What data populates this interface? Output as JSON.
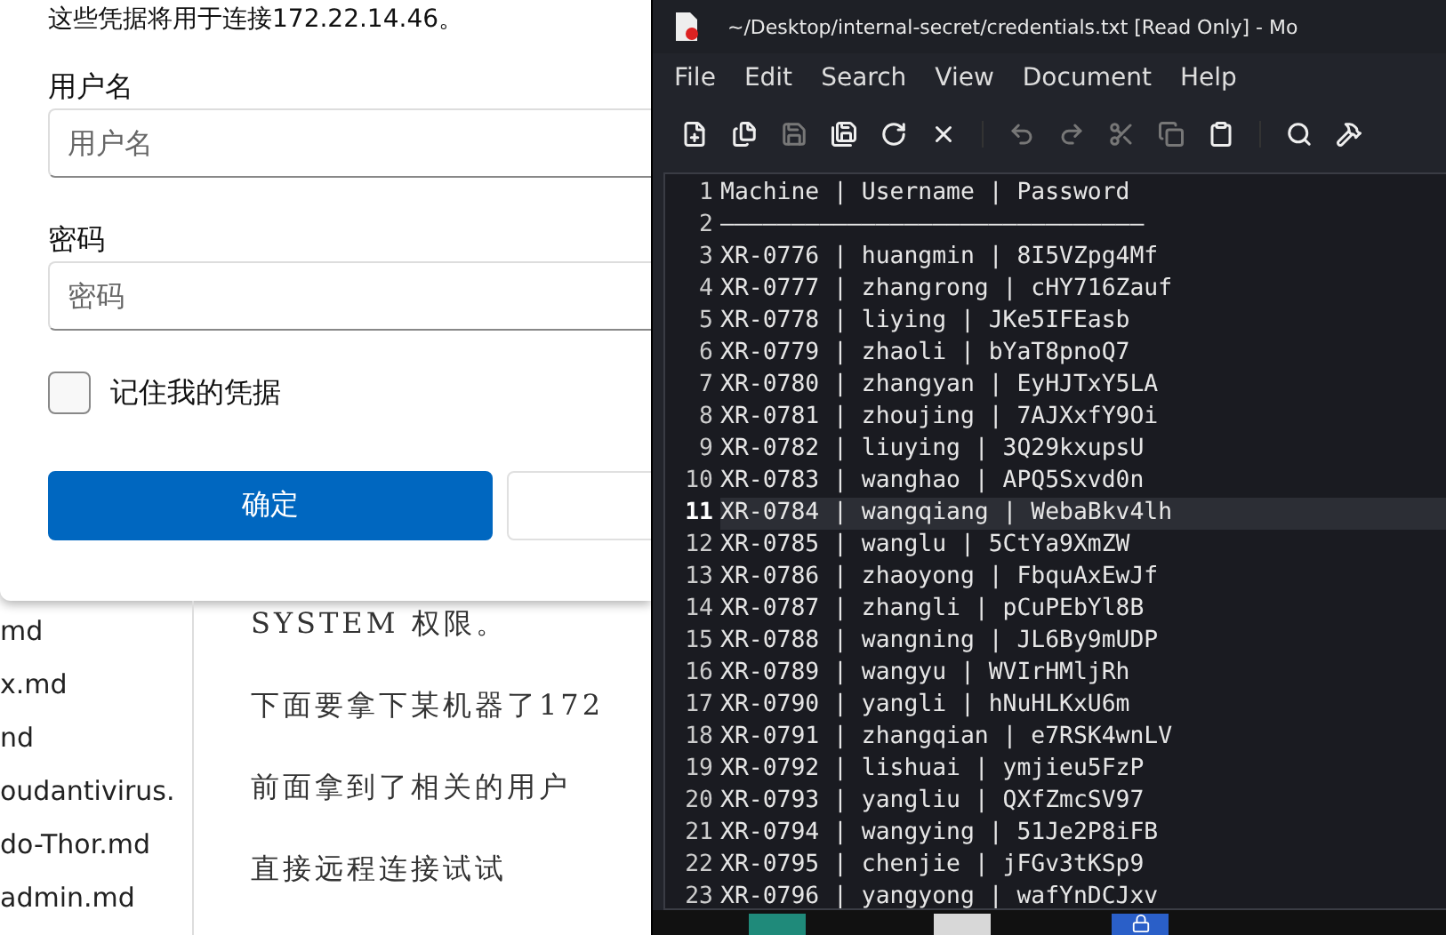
{
  "dialog": {
    "message": "这些凭据将用于连接172.22.14.46。",
    "fields": [
      {
        "label": "用户名",
        "placeholder": "用户名"
      },
      {
        "label": "密码",
        "placeholder": "密码"
      }
    ],
    "remember": {
      "label": "记住我的凭据",
      "checked": false
    },
    "buttons": [
      {
        "label": "确定",
        "primary": true
      },
      {
        "primary": false
      }
    ]
  },
  "background_doc": {
    "sidebar_items": [
      "md",
      "x.md",
      "nd",
      "oudantivirus.",
      "do-Thor.md",
      "admin.md"
    ],
    "paragraphs": [
      "SYSTEM 权限。",
      "下面要拿下某机器了172",
      "前面拿到了相关的用户",
      "直接远程连接试试"
    ]
  },
  "editor": {
    "title": "~/Desktop/internal-secret/credentials.txt [Read Only] - Mo",
    "menu": [
      "File",
      "Edit",
      "Search",
      "View",
      "Document",
      "Help"
    ],
    "toolbar": [
      [
        {
          "disabled": false
        },
        {
          "disabled": false
        },
        {
          "disabled": true
        },
        {
          "disabled": false
        },
        {
          "disabled": false
        },
        {
          "disabled": false
        }
      ],
      [
        {
          "disabled": true
        },
        {
          "disabled": true
        },
        {
          "disabled": true
        },
        {
          "disabled": true
        },
        {
          "disabled": false
        }
      ],
      [
        {
          "disabled": false
        },
        {
          "disabled": false
        }
      ]
    ],
    "lines": [
      {
        "number": "1",
        "text": "Machine | Username | Password",
        "selected": false
      },
      {
        "number": "2",
        "text": "——————————————————————————————",
        "selected": false
      },
      {
        "number": "3",
        "text": "XR-0776 | huangmin | 8I5VZpg4Mf",
        "selected": false
      },
      {
        "number": "4",
        "text": "XR-0777 | zhangrong | cHY716Zauf",
        "selected": false
      },
      {
        "number": "5",
        "text": "XR-0778 | liying | JKe5IFEasb",
        "selected": false
      },
      {
        "number": "6",
        "text": "XR-0779 | zhaoli | bYaT8pnoQ7",
        "selected": false
      },
      {
        "number": "7",
        "text": "XR-0780 | zhangyan | EyHJTxY5LA",
        "selected": false
      },
      {
        "number": "8",
        "text": "XR-0781 | zhoujing | 7AJXxfY9Oi",
        "selected": false
      },
      {
        "number": "9",
        "text": "XR-0782 | liuying | 3Q29kxupsU",
        "selected": false
      },
      {
        "number": "10",
        "text": "XR-0783 | wanghao | APQ5Sxvd0n",
        "selected": false
      },
      {
        "number": "11",
        "text": "XR-0784 | wangqiang | WebaBkv4lh",
        "selected": true
      },
      {
        "number": "12",
        "text": "XR-0785 | wanglu | 5CtYa9XmZW",
        "selected": false
      },
      {
        "number": "13",
        "text": "XR-0786 | zhaoyong | FbquAxEwJf",
        "selected": false
      },
      {
        "number": "14",
        "text": "XR-0787 | zhangli | pCuPEbYl8B",
        "selected": false
      },
      {
        "number": "15",
        "text": "XR-0788 | wangning | JL6By9mUDP",
        "selected": false
      },
      {
        "number": "16",
        "text": "XR-0789 | wangyu | WVIrHMljRh",
        "selected": false
      },
      {
        "number": "17",
        "text": "XR-0790 | yangli | hNuHLKxU6m",
        "selected": false
      },
      {
        "number": "18",
        "text": "XR-0791 | zhangqian | e7RSK4wnLV",
        "selected": false
      },
      {
        "number": "19",
        "text": "XR-0792 | lishuai | ymjieu5FzP",
        "selected": false
      },
      {
        "number": "20",
        "text": "XR-0793 | yangliu | QXfZmcSV97",
        "selected": false
      },
      {
        "number": "21",
        "text": "XR-0794 | wangying | 51Je2P8iFB",
        "selected": false
      },
      {
        "number": "22",
        "text": "XR-0795 | chenjie | jFGv3tKSp9",
        "selected": false
      },
      {
        "number": "23",
        "text": "XR-0796 | yangyong | wafYnDCJxv",
        "selected": false
      }
    ]
  }
}
